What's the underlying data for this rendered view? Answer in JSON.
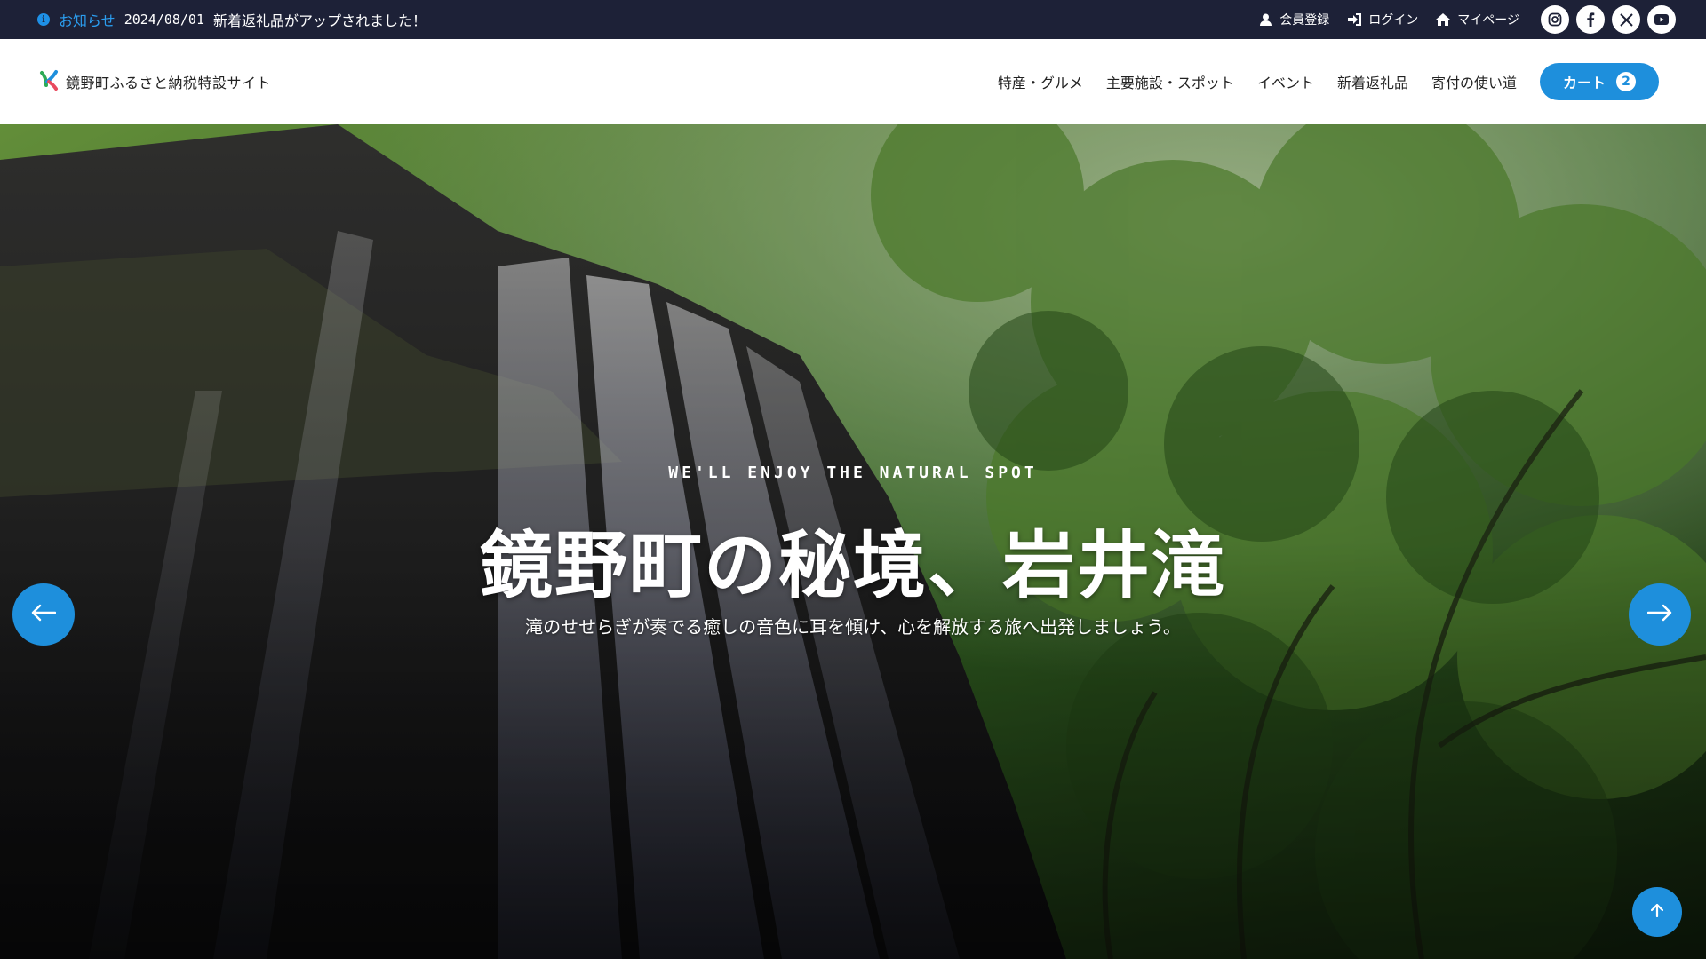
{
  "notice": {
    "icon": "info-icon",
    "label": "お知らせ",
    "date": "2024/08/01",
    "text": "新着返礼品がアップされました！"
  },
  "top_links": [
    {
      "icon": "user-icon",
      "label": "会員登録"
    },
    {
      "icon": "login-icon",
      "label": "ログイン"
    },
    {
      "icon": "home-icon",
      "label": "マイページ"
    }
  ],
  "socials": [
    "instagram-icon",
    "facebook-icon",
    "x-icon",
    "youtube-icon"
  ],
  "header": {
    "site_name": "鏡野町ふるさと納税特設サイト",
    "nav": [
      "特産・グルメ",
      "主要施設・スポット",
      "イベント",
      "新着返礼品",
      "寄付の使い道"
    ],
    "cart_label": "カート",
    "cart_count": "2"
  },
  "hero": {
    "eyebrow": "WE'LL ENJOY THE NATURAL SPOT",
    "title": "鏡野町の秘境、岩井滝",
    "subtitle": "滝のせせらぎが奏でる癒しの音色に耳を傾け、心を解放する旅へ出発しましょう。"
  },
  "colors": {
    "topbar_bg": "#1d2137",
    "accent": "#1e8fdc",
    "notice_label": "#2b9ef0"
  }
}
